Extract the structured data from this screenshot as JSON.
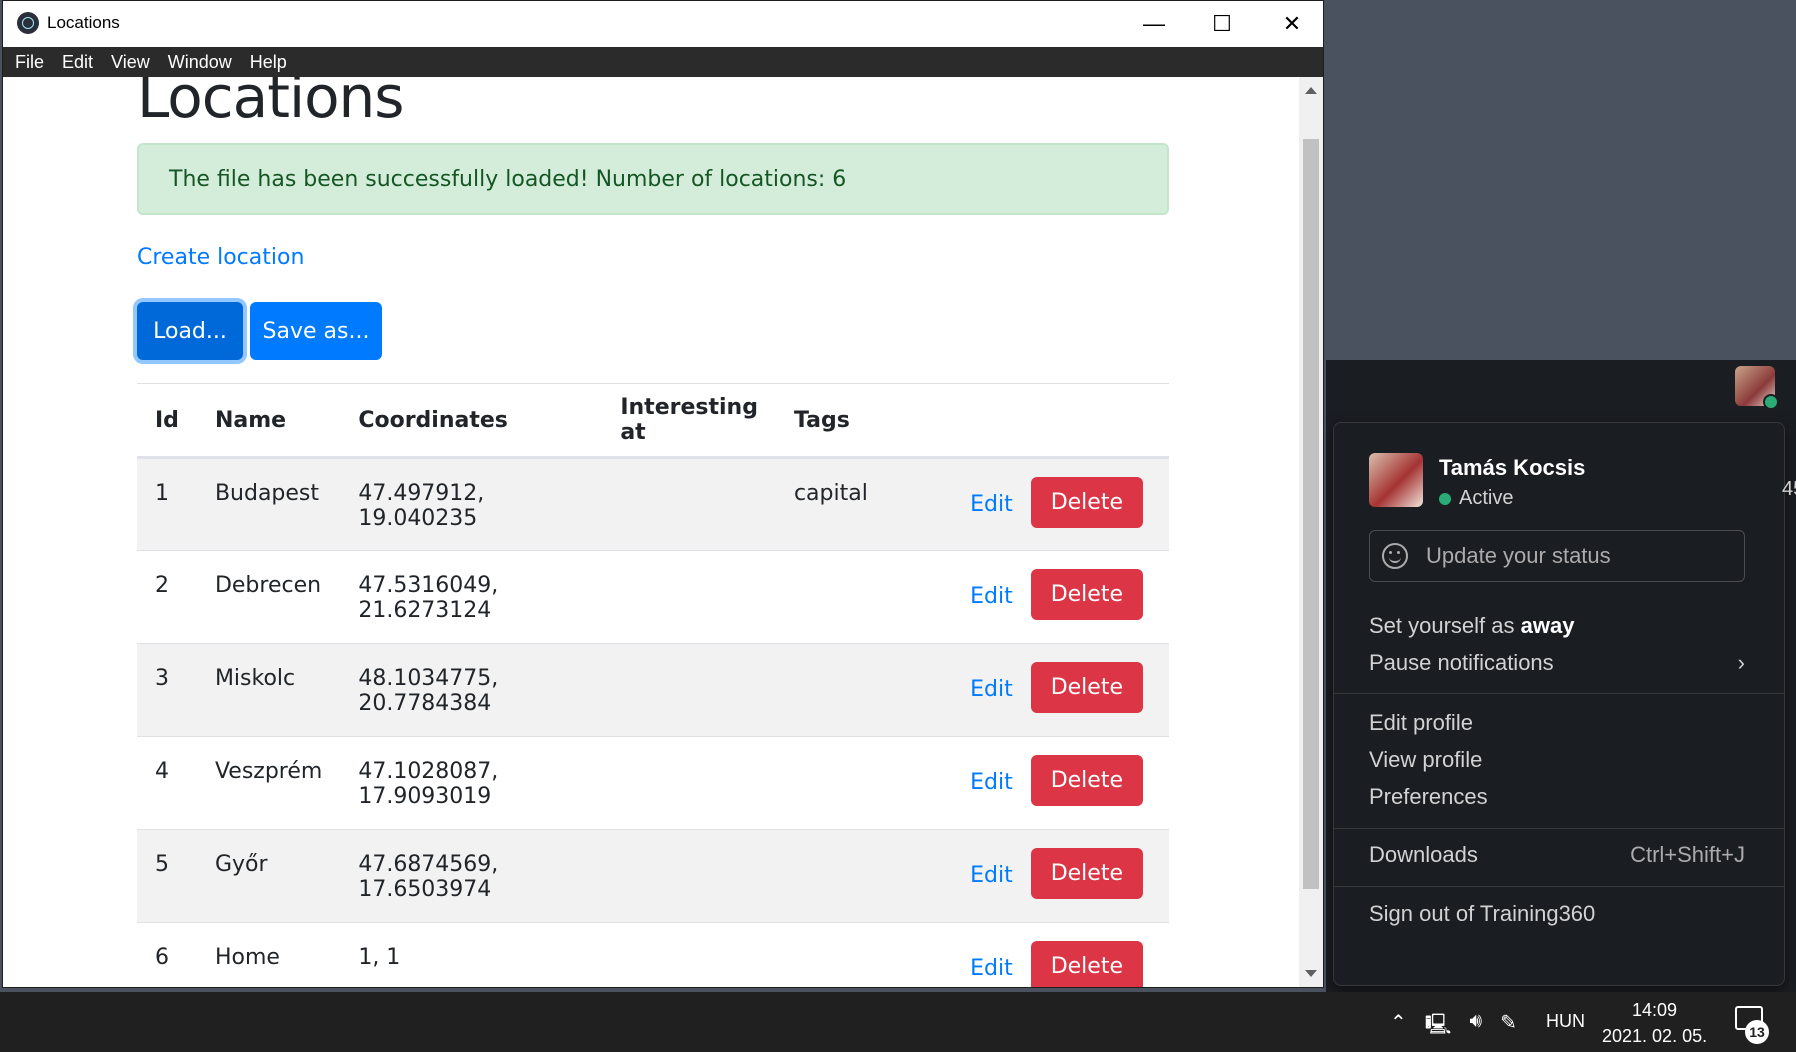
{
  "window": {
    "title": "Locations",
    "controls": {
      "minimize": "—",
      "maximize": "☐",
      "close": "✕"
    },
    "menu": [
      "File",
      "Edit",
      "View",
      "Window",
      "Help"
    ]
  },
  "page": {
    "heading": "Locations",
    "alert": "The file has been successfully loaded! Number of locations: 6",
    "create_link": "Create location",
    "load_button": "Load...",
    "save_button": "Save as...",
    "columns": [
      "Id",
      "Name",
      "Coordinates",
      "Interesting at",
      "Tags"
    ],
    "rows": [
      {
        "id": "1",
        "name": "Budapest",
        "coords": "47.497912, 19.040235",
        "interesting": "",
        "tags": "capital"
      },
      {
        "id": "2",
        "name": "Debrecen",
        "coords": "47.5316049, 21.6273124",
        "interesting": "",
        "tags": ""
      },
      {
        "id": "3",
        "name": "Miskolc",
        "coords": "48.1034775, 20.7784384",
        "interesting": "",
        "tags": ""
      },
      {
        "id": "4",
        "name": "Veszprém",
        "coords": "47.1028087, 17.9093019",
        "interesting": "",
        "tags": ""
      },
      {
        "id": "5",
        "name": "Győr",
        "coords": "47.6874569, 17.6503974",
        "interesting": "",
        "tags": ""
      },
      {
        "id": "6",
        "name": "Home",
        "coords": "1, 1",
        "interesting": "",
        "tags": ""
      }
    ],
    "edit_label": "Edit",
    "delete_label": "Delete"
  },
  "slack_menu": {
    "user_name": "Tamás Kocsis",
    "status": "Active",
    "status_placeholder": "Update your status",
    "away_prefix": "Set yourself as ",
    "away_bold": "away",
    "pause": "Pause notifications",
    "pause_chevron": "›",
    "edit_profile": "Edit profile",
    "view_profile": "View profile",
    "preferences": "Preferences",
    "downloads": "Downloads",
    "downloads_shortcut": "Ctrl+Shift+J",
    "sign_out": "Sign out of Training360"
  },
  "taskbar": {
    "language": "HUN",
    "time": "14:09",
    "date": "2021. 02. 05.",
    "notifications_count": "13"
  },
  "colors": {
    "primary": "#007bff",
    "danger": "#dc3545",
    "success_bg": "#d4edda",
    "slack_bg": "#1a1d21"
  }
}
